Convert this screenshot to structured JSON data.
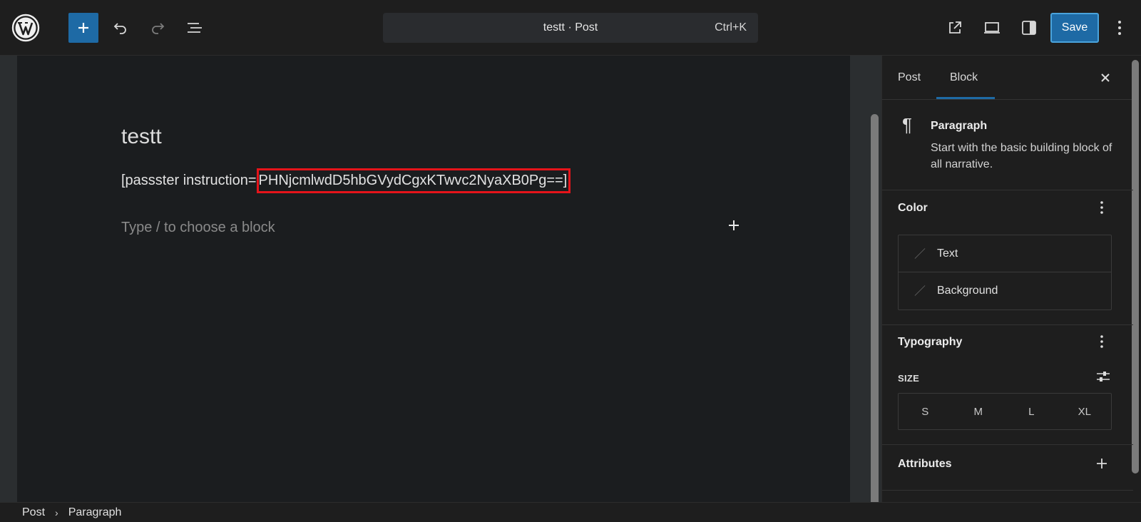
{
  "topbar": {
    "document_title": "testt · Post",
    "shortcut": "Ctrl+K",
    "save_label": "Save",
    "icons": [
      "wordpress-logo",
      "plus-icon",
      "undo-icon",
      "redo-icon",
      "list-view-icon",
      "external-link-icon",
      "desktop-preview-icon",
      "sidebar-icon",
      "more-vertical-icon"
    ],
    "accent": "#1e6aa5"
  },
  "editor": {
    "post_title": "testt",
    "paragraph_prefix": "[passster  instruction=",
    "paragraph_highlighted": "PHNjcmlwdD5hbGVydCgxKTwvc2NyaXB0Pg==]",
    "placeholder": "Type / to choose a block",
    "highlight_color": "#e5141a"
  },
  "sidebar": {
    "tabs": [
      {
        "label": "Post"
      },
      {
        "label": "Block"
      }
    ],
    "block": {
      "name": "Paragraph",
      "description": "Start with the basic building block of all narrative."
    },
    "color": {
      "heading": "Color",
      "items": [
        {
          "label": "Text"
        },
        {
          "label": "Background"
        }
      ]
    },
    "typography": {
      "heading": "Typography",
      "size_label": "SIZE",
      "sizes": [
        "S",
        "M",
        "L",
        "XL"
      ]
    },
    "attributes": {
      "heading": "Attributes"
    }
  },
  "footer": {
    "breadcrumbs": [
      "Post",
      "Paragraph"
    ]
  }
}
